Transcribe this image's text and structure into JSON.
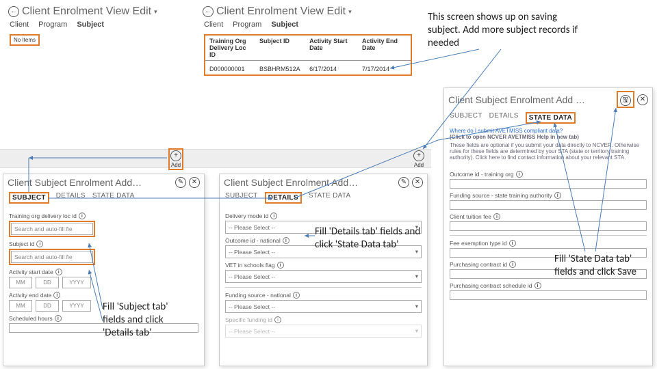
{
  "annotations": {
    "top_right": "This screen shows up on saving subject. Add more subject records if needed",
    "subject_tab": "Fill 'Subject tab' fields and click 'Details tab'",
    "details_tab": "Fill 'Details tab' fields and click 'State Data tab'",
    "state_data_tab": "Fill 'State Data tab' fields and click Save"
  },
  "header_a": {
    "title": "Client Enrolment View Edit",
    "tabs": [
      "Client",
      "Program",
      "Subject"
    ],
    "active_tab": "Subject",
    "no_items": "No Items"
  },
  "header_b": {
    "title": "Client Enrolment View Edit",
    "tabs": [
      "Client",
      "Program",
      "Subject"
    ],
    "active_tab": "Subject",
    "table": {
      "cols": [
        "Training Org Delivery Loc ID",
        "Subject ID",
        "Activity Start Date",
        "Activity End Date"
      ],
      "row": [
        "D000000001",
        "BSBHRM512A",
        "6/17/2014",
        "7/17/2014"
      ]
    }
  },
  "add_label": "Add",
  "pane_subject": {
    "title": "Client Subject Enrolment Add…",
    "tabs": [
      "SUBJECT",
      "DETAILS",
      "STATE DATA"
    ],
    "active": "SUBJECT",
    "fields": {
      "training_loc": "Training org delivery loc id",
      "subject_id": "Subject id",
      "search_ph": "Search and auto-fill fie",
      "activity_start": "Activity start date",
      "activity_end": "Activity end date",
      "scheduled_hours": "Scheduled hours",
      "mm": "MM",
      "dd": "DD",
      "yyyy": "YYYY"
    }
  },
  "pane_details": {
    "title": "Client Subject Enrolment Add…",
    "tabs": [
      "SUBJECT",
      "DETAILS",
      "STATE DATA"
    ],
    "active": "DETAILS",
    "fields": {
      "delivery_mode": "Delivery mode id",
      "outcome_national": "Outcome id - national",
      "vet_schools": "VET in schools flag",
      "funding_national": "Funding source - national",
      "specific_funding": "Specific funding id",
      "please_select": "-- Please Select --"
    }
  },
  "pane_state": {
    "title": "Client Subject Enrolment Add …",
    "tabs": [
      "SUBJECT",
      "DETAILS",
      "STATE DATA"
    ],
    "active": "STATE DATA",
    "help_q": "Where do I submit AVETMISS compliant data?",
    "help_link": "(Click to open NCVER AVETMISS Help in new tab)",
    "help_body": "These fields are optional if you submit your data directly to NCVER. Otherwise rules for these fields are determined by your STA (state or territory training authority). Click here to find contact information about your relevant STA.",
    "fields": {
      "outcome_training": "Outcome id - training org",
      "funding_state": "Funding source - state training authority",
      "client_tuition": "Client tuition fee",
      "fee_exemption": "Fee exemption type id",
      "purchasing_contract": "Purchasing contract id",
      "purchasing_schedule": "Purchasing contract schedule id"
    }
  }
}
